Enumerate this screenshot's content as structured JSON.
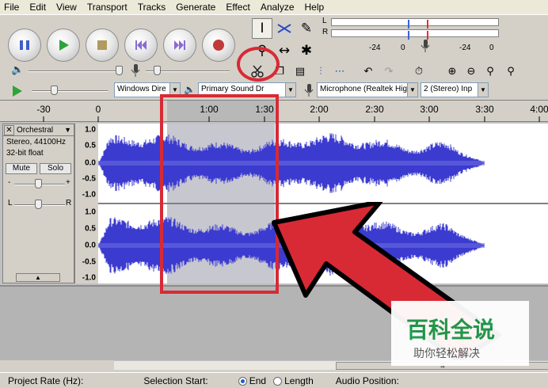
{
  "menu": [
    "File",
    "Edit",
    "View",
    "Transport",
    "Tracks",
    "Generate",
    "Effect",
    "Analyze",
    "Help"
  ],
  "transport_buttons": [
    {
      "name": "pause-button",
      "icon": "pause-icon",
      "color": "#3c5ec9"
    },
    {
      "name": "play-button",
      "icon": "play-icon",
      "color": "#2fa33a"
    },
    {
      "name": "stop-button",
      "icon": "stop-icon",
      "color": "#a8965c"
    },
    {
      "name": "skip-start-button",
      "icon": "skip-start-icon",
      "color": "#8a6bd6"
    },
    {
      "name": "skip-end-button",
      "icon": "skip-end-icon",
      "color": "#8a6bd6"
    },
    {
      "name": "record-button",
      "icon": "record-icon",
      "color": "#c03a3a"
    }
  ],
  "tools": [
    "selection-tool-icon",
    "envelope-tool-icon",
    "draw-tool-icon",
    "zoom-tool-icon",
    "timeshift-tool-icon",
    "multi-tool-icon"
  ],
  "meters": {
    "playback_labels": [
      "L",
      "R"
    ],
    "scale_left": "-24",
    "scale_mid": "0",
    "scale_right": "-24",
    "scale_right2": "0"
  },
  "ruler": {
    "ticks": [
      "-30",
      "0",
      "1:00",
      "1:30",
      "2:00",
      "2:30",
      "3:00",
      "3:30",
      "4:00"
    ],
    "selection_label": "1:00",
    "selection_label2": "1:30"
  },
  "devices": {
    "host": "Windows Dire",
    "output": "Primary Sound Dr",
    "input": "Microphone (Realtek Hig",
    "channels": "2 (Stereo) Inp"
  },
  "track": {
    "name": "Orchestral",
    "format_line1": "Stereo, 44100Hz",
    "format_line2": "32-bit float",
    "mute": "Mute",
    "solo": "Solo",
    "pan_left": "L",
    "pan_right": "R",
    "gain_minus": "-",
    "gain_plus": "+",
    "scale_top": [
      "1.0",
      "0.5",
      "0.0",
      "-0.5",
      "-1.0"
    ],
    "scale_bottom": [
      "1.0",
      "0.5",
      "0.0",
      "-0.5",
      "-1.0"
    ]
  },
  "statusbar": {
    "project_rate": "Project Rate (Hz):",
    "selection_start": "Selection Start:",
    "end": "End",
    "length": "Length",
    "audio_position": "Audio Position:"
  },
  "watermark": {
    "logo": "百科全说",
    "sub": "助你轻松解决"
  },
  "colors": {
    "waveform": "#3b3bd0",
    "waveform_rms": "#6a6ae0",
    "selection": "#c7c7cf",
    "highlight": "#d82a35",
    "arrow": "#d82a35"
  }
}
